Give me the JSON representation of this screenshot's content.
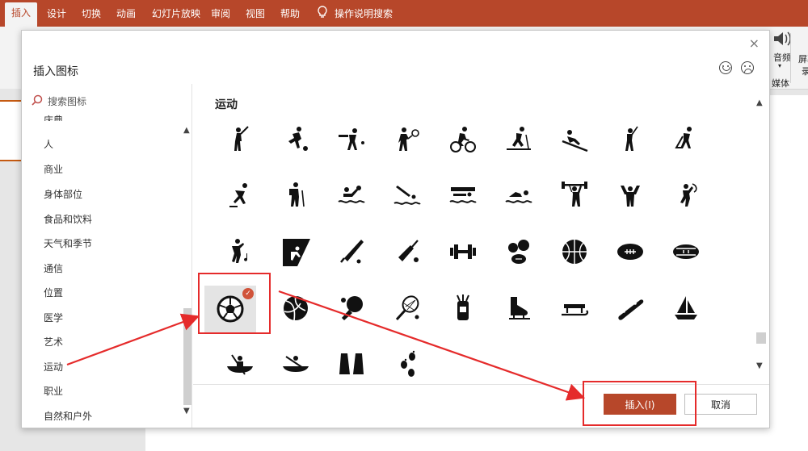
{
  "ribbon": {
    "tabs": [
      "插入",
      "设计",
      "切换",
      "动画",
      "幻灯片放映",
      "审阅",
      "视图",
      "帮助"
    ],
    "active_tab": "插入",
    "tell_me": "操作说明搜索",
    "audio_label": "音频",
    "media_group": "媒体",
    "screen_rec_label": "屏幕录",
    "screen_rec_label2": "录"
  },
  "dialog": {
    "title": "插入图标",
    "close_glyph": "×",
    "search_placeholder": "搜索图标",
    "categories": [
      "庆典",
      "人",
      "商业",
      "身体部位",
      "食品和饮料",
      "天气和季节",
      "通信",
      "位置",
      "医学",
      "艺术",
      "运动",
      "职业",
      "自然和户外"
    ],
    "selected_category": "运动",
    "section_title": "运动",
    "icons": [
      [
        "baseball-batter",
        "soccer-kick",
        "cricket-batter",
        "tennis-player",
        "cyclist",
        "cross-country-skier",
        "downhill-skier",
        "golfer",
        "hockey-player"
      ],
      [
        "speed-skater",
        "hiker",
        "water-polo",
        "diver",
        "swimmer-wave",
        "swimmer",
        "weightlifter",
        "gymnast-rings",
        "rhythmic-gymnast"
      ],
      [
        "dancer",
        "rock-climber",
        "baseball-bat",
        "cricket-bat",
        "dumbbell",
        "sports-balls",
        "basketball",
        "american-football",
        "rugby-ball"
      ],
      [
        "soccer-ball",
        "volleyball",
        "table-tennis",
        "tennis-racket",
        "golf-bag",
        "ice-skate",
        "sled",
        "skateboard",
        "sailboat"
      ],
      [
        "canoe",
        "kayak",
        "swim-fins",
        "footprints"
      ]
    ],
    "selected_icon": "soccer-ball",
    "check_glyph": "✓",
    "insert_button": "插入(I)",
    "cancel_button": "取消"
  },
  "colors": {
    "accent": "#b7472a",
    "annotation": "#e52b2b",
    "badge": "#d0533a"
  }
}
